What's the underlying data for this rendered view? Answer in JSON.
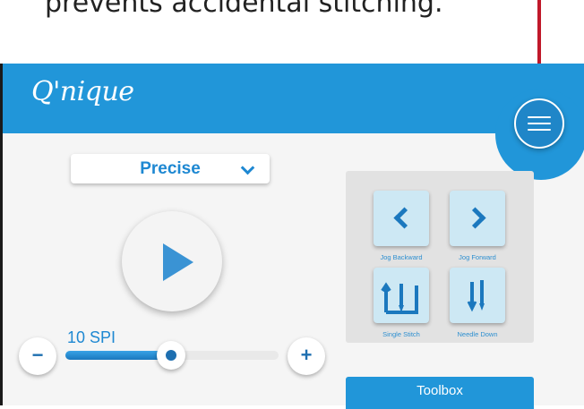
{
  "caption": "prevents accidental stitching.",
  "header": {
    "logo": "Q'nique"
  },
  "menu": {
    "icon": "hamburger-menu-icon"
  },
  "mode_select": {
    "value": "Precise"
  },
  "play": {
    "icon": "play-icon"
  },
  "spi": {
    "label": "10 SPI",
    "slider_fraction": 0.5,
    "decrease": "−",
    "increase": "+"
  },
  "jog": {
    "backward": "Jog Backward",
    "forward": "Jog Forward",
    "single_stitch": "Single Stitch",
    "needle_down": "Needle Down"
  },
  "toolbox": {
    "label": "Toolbox"
  },
  "colors": {
    "accent": "#2196d9",
    "annotation_arrow": "#c0182a",
    "tile": "#cde8f4"
  }
}
